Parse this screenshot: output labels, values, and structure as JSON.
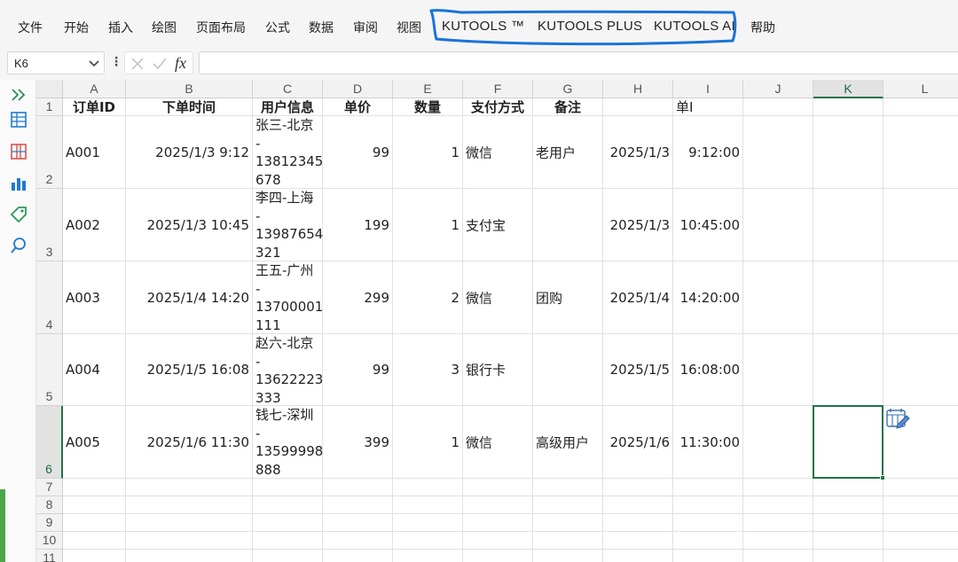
{
  "ribbon": {
    "tabs": [
      "文件",
      "开始",
      "插入",
      "绘图",
      "页面布局",
      "公式",
      "数据",
      "审阅",
      "视图"
    ],
    "kutools_tabs": [
      "KUTOOLS ™",
      "KUTOOLS PLUS",
      "KUTOOLS AI"
    ],
    "help": "帮助",
    "annotation_color": "#1a73d9"
  },
  "formula_bar": {
    "name_box": "K6",
    "fx": "fx",
    "value": ""
  },
  "side_panel": {
    "icons": [
      "expand-icon",
      "table-icon",
      "columns-icon",
      "bar-chart-icon",
      "tag-icon",
      "search-icon"
    ],
    "accent": "#1f7ad1"
  },
  "sheet": {
    "columns": [
      "A",
      "B",
      "C",
      "D",
      "E",
      "F",
      "G",
      "H",
      "I",
      "J",
      "K",
      "L"
    ],
    "rows": [
      "1",
      "2",
      "3",
      "4",
      "5",
      "6",
      "7",
      "8",
      "9",
      "10",
      "11"
    ],
    "selected_cell": "K6",
    "header": [
      "订单ID",
      "下单时间",
      "用户信息",
      "单价",
      "数量",
      "支付方式",
      "备注",
      "",
      "单I"
    ],
    "data": [
      {
        "id": "A001",
        "time": "2025/1/3 9:12",
        "user": [
          "张三-北京",
          "-",
          "13812345",
          "678"
        ],
        "price": "99",
        "qty": "1",
        "pay": "微信",
        "note": "老用户",
        "date": "2025/1/3",
        "clock": "9:12:00"
      },
      {
        "id": "A002",
        "time": "2025/1/3 10:45",
        "user": [
          "李四-上海",
          "-",
          "13987654",
          "321"
        ],
        "price": "199",
        "qty": "1",
        "pay": "支付宝",
        "note": "",
        "date": "2025/1/3",
        "clock": "10:45:00"
      },
      {
        "id": "A003",
        "time": "2025/1/4 14:20",
        "user": [
          "王五-广州",
          "-",
          "13700001",
          "111"
        ],
        "price": "299",
        "qty": "2",
        "pay": "微信",
        "note": "团购",
        "date": "2025/1/4",
        "clock": "14:20:00"
      },
      {
        "id": "A004",
        "time": "2025/1/5 16:08",
        "user": [
          "赵六-北京",
          "-",
          "13622223",
          "333"
        ],
        "price": "99",
        "qty": "3",
        "pay": "银行卡",
        "note": "",
        "date": "2025/1/5",
        "clock": "16:08:00"
      },
      {
        "id": "A005",
        "time": "2025/1/6 11:30",
        "user": [
          "钱七-深圳",
          "-",
          "13599998",
          "888"
        ],
        "price": "399",
        "qty": "1",
        "pay": "微信",
        "note": "高级用户",
        "date": "2025/1/6",
        "clock": "11:30:00"
      }
    ]
  },
  "colors": {
    "grid_line": "#e1e1e1",
    "header_bg": "#f2f2f2",
    "selection": "#217346"
  }
}
